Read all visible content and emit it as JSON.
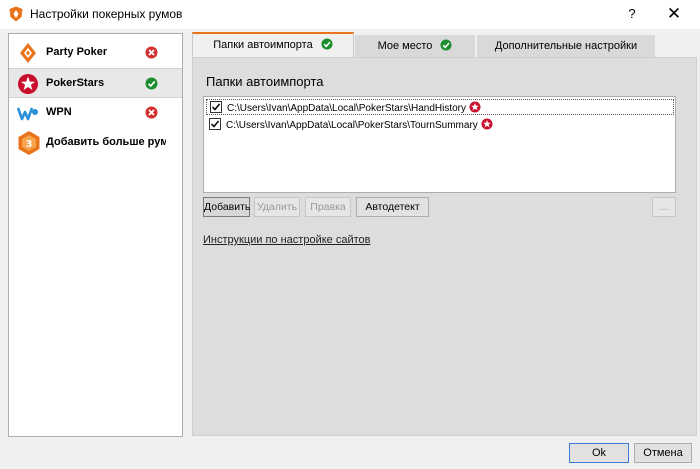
{
  "window": {
    "title": "Настройки покерных румов",
    "help_label": "?",
    "close_label": "✕"
  },
  "sidebar": {
    "items": [
      {
        "label": "Party Poker",
        "status": "error",
        "icon": "party-poker-icon"
      },
      {
        "label": "PokerStars",
        "status": "ok",
        "icon": "pokerstars-icon",
        "selected": true
      },
      {
        "label": "WPN",
        "status": "error",
        "icon": "wpn-icon"
      },
      {
        "label": "Добавить больше румов",
        "icon": "add-rooms-icon"
      }
    ]
  },
  "tabs": [
    {
      "label": "Папки автоимпорта",
      "status": "ok",
      "active": true
    },
    {
      "label": "Мое место",
      "status": "ok"
    },
    {
      "label": "Дополнительные настройки"
    }
  ],
  "panel": {
    "title": "Папки автоимпорта",
    "folders": [
      {
        "path": "C:\\Users\\Ivan\\AppData\\Local\\PokerStars\\HandHistory",
        "checked": true
      },
      {
        "path": "C:\\Users\\Ivan\\AppData\\Local\\PokerStars\\TournSummary",
        "checked": true
      }
    ],
    "buttons": {
      "add": "Добавить",
      "delete": "Удалить",
      "edit": "Правка",
      "autodetect": "Автодетект",
      "more": "..."
    },
    "help_link": "Инструкции по настройке сайтов"
  },
  "footer": {
    "ok": "Ok",
    "cancel": "Отмена"
  },
  "colors": {
    "accent": "#e8731a",
    "ok_green": "#1e8f2e",
    "error_red": "#d32f2f",
    "pokerstars_red": "#c8102e"
  }
}
